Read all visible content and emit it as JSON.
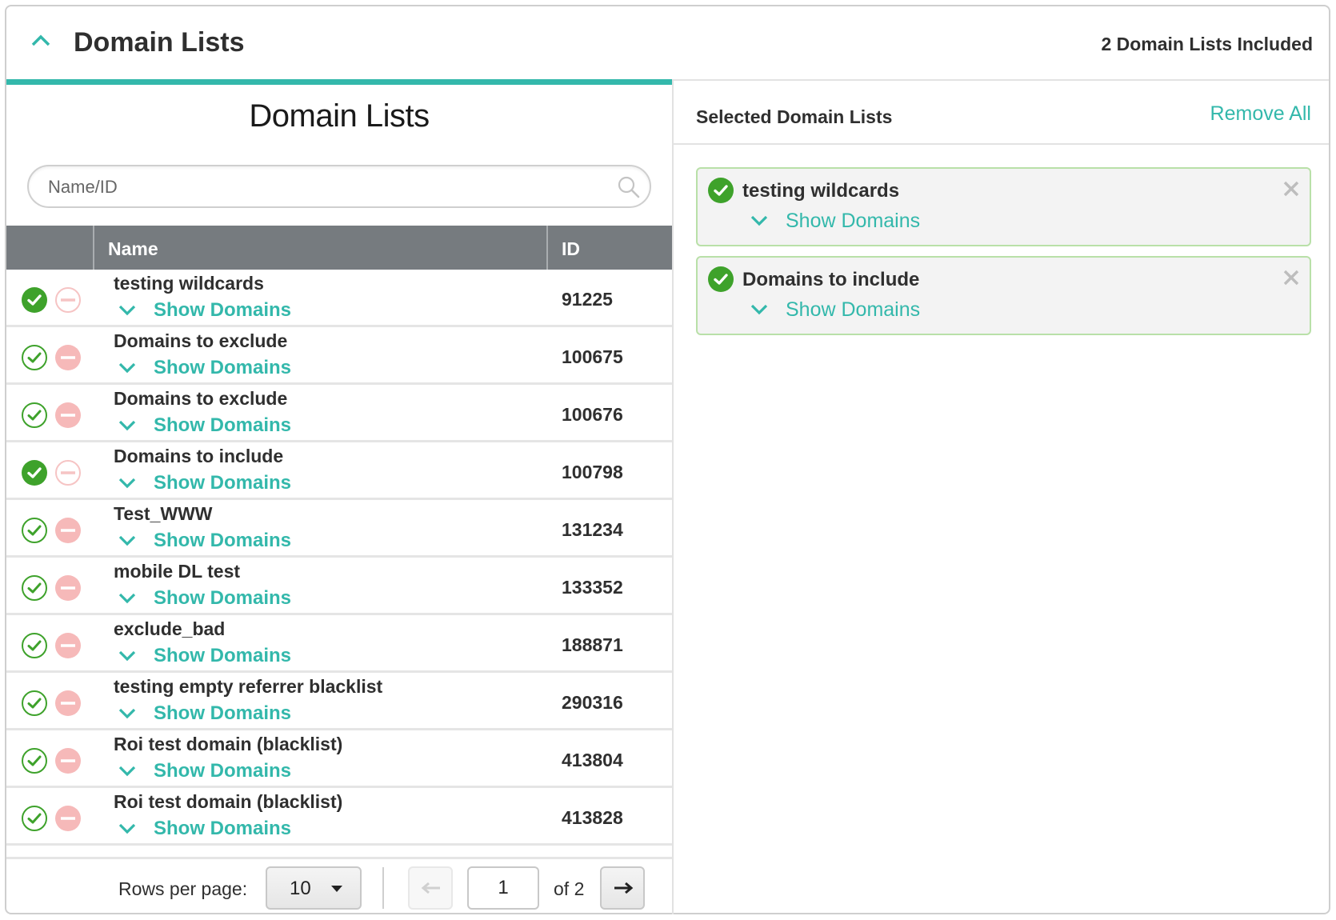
{
  "header": {
    "title": "Domain Lists",
    "count_label": "2 Domain Lists Included",
    "collapse_icon": "chevron-up-icon"
  },
  "colors": {
    "accent": "#33b8ab",
    "include_green": "#3ea22b",
    "exclude_pink": "#f6b9b9",
    "table_header": "#767b7f",
    "selected_border": "#b9e0a8"
  },
  "left_panel": {
    "title": "Domain Lists",
    "search": {
      "placeholder": "Name/ID",
      "value": ""
    },
    "table": {
      "columns": [
        "",
        "Name",
        "ID"
      ],
      "rows": [
        {
          "name": "testing wildcards",
          "id": "91225",
          "included": true,
          "show_label": "Show Domains"
        },
        {
          "name": "Domains to exclude",
          "id": "100675",
          "included": false,
          "show_label": "Show Domains"
        },
        {
          "name": "Domains to exclude",
          "id": "100676",
          "included": false,
          "show_label": "Show Domains"
        },
        {
          "name": "Domains to include",
          "id": "100798",
          "included": true,
          "show_label": "Show Domains"
        },
        {
          "name": "Test_WWW",
          "id": "131234",
          "included": false,
          "show_label": "Show Domains"
        },
        {
          "name": "mobile DL test",
          "id": "133352",
          "included": false,
          "show_label": "Show Domains"
        },
        {
          "name": "exclude_bad",
          "id": "188871",
          "included": false,
          "show_label": "Show Domains"
        },
        {
          "name": "testing empty referrer blacklist",
          "id": "290316",
          "included": false,
          "show_label": "Show Domains"
        },
        {
          "name": "Roi test domain (blacklist)",
          "id": "413804",
          "included": false,
          "show_label": "Show Domains"
        },
        {
          "name": "Roi test domain (blacklist)",
          "id": "413828",
          "included": false,
          "show_label": "Show Domains"
        }
      ]
    },
    "pagination": {
      "rows_per_page_label": "Rows per page:",
      "rows_per_page_value": "10",
      "current_page": "1",
      "of_label": "of 2"
    }
  },
  "right_panel": {
    "title": "Selected Domain Lists",
    "remove_all_label": "Remove All",
    "items": [
      {
        "name": "testing wildcards",
        "show_label": "Show Domains"
      },
      {
        "name": "Domains to include",
        "show_label": "Show Domains"
      }
    ]
  }
}
